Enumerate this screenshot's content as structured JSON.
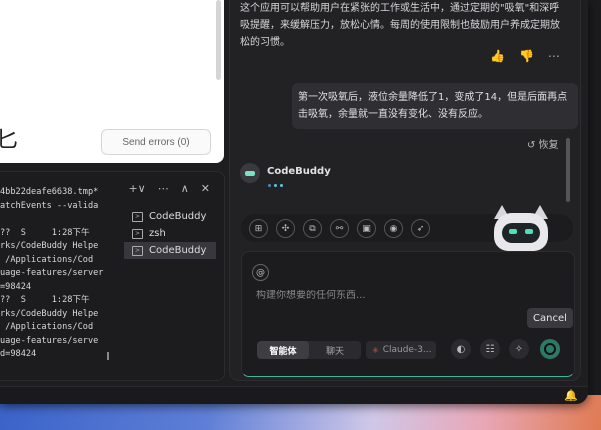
{
  "errors_panel": {
    "partial_char": "匕",
    "send_errors_label": "Send errors (0)"
  },
  "terminal": {
    "tools": [
      "+∨",
      "⋯",
      "∧",
      "✕"
    ],
    "lines": [
      "4bb22deafe6638.tmp*",
      "atchEvents --valida",
      "",
      "??  S     1:28下午",
      "rks/CodeBuddy Helpe",
      " /Applications/Cod",
      "uage-features/server",
      "=98424",
      "??  S     1:28下午",
      "rks/CodeBuddy Helpe",
      " /Applications/Cod",
      "uage-features/serve",
      "d=98424"
    ],
    "tabs": [
      {
        "label": "CodeBuddy"
      },
      {
        "label": "zsh"
      },
      {
        "label": "CodeBuddy"
      }
    ]
  },
  "chat": {
    "assistant_message": "这个应用可以帮助用户在紧张的工作或生活中，通过定期的\"吸氧\"和深呼吸提醒，来缓解压力，放松心情。每周的使用限制也鼓励用户养成定期放松的习惯。",
    "message_actions": [
      "👍",
      "👎",
      "⋯"
    ],
    "user_message": "第一次吸氧后，液位余量降低了1，变成了14，但是后面再点击吸氧，余量就一直没有变化、没有反应。",
    "restore_label": "↺ 恢复",
    "bot_name": "CodeBuddy",
    "tool_icons": [
      "⊞",
      "✣",
      "⧉",
      "⚯",
      "▣",
      "◉",
      "➶"
    ],
    "composer": {
      "at_symbol": "@",
      "placeholder": "构建你想要的任何东西...",
      "modes": [
        "智能体",
        "聊天"
      ],
      "selected_mode": "智能体",
      "model": "Claude-3...",
      "stop_tooltip": "Cancel"
    }
  },
  "statusbar": {
    "bell_icon": "🔔"
  }
}
